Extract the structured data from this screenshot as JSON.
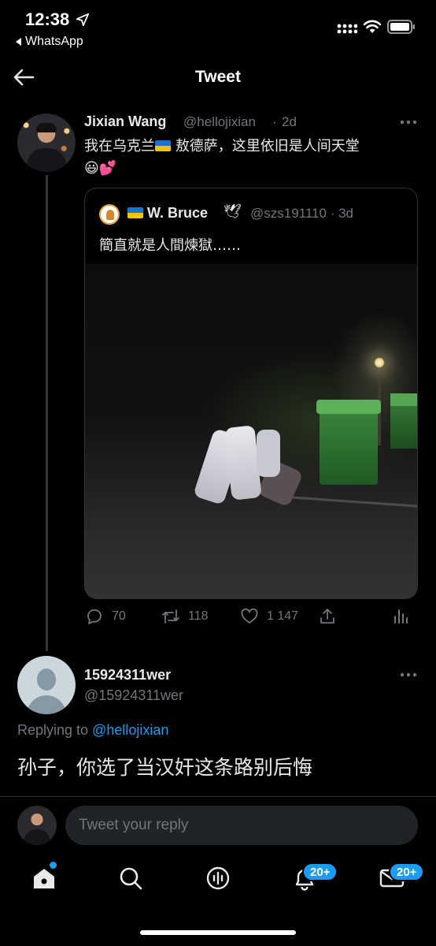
{
  "status_bar": {
    "time": "12:38",
    "back_app": "WhatsApp"
  },
  "header": {
    "title": "Tweet"
  },
  "tweet": {
    "name": "Jixian Wang",
    "handle": "@hellojixian",
    "age": "2d",
    "text_before_flag": "我在乌克兰",
    "text_after_flag": "敖德萨，这里依旧是人间天堂",
    "emoji_line": "😃💕",
    "quoted": {
      "name": "W. Bruce",
      "name_emoji": "🕊",
      "handle": "@szs191110",
      "age": "3d",
      "text": "簡直就是人間煉獄……"
    },
    "actions": {
      "replies": "70",
      "retweets": "118",
      "likes": "1 147"
    }
  },
  "reply": {
    "name": "15924311wer",
    "handle": "@15924311wer",
    "replying_prefix": "Replying to",
    "replying_to": "@hellojixian",
    "text": "孙子，你选了当汉奸这条路别后悔"
  },
  "compose": {
    "placeholder": "Tweet your reply"
  },
  "tab_bar": {
    "notifications_badge": "20+",
    "messages_badge": "20+"
  },
  "colors": {
    "accent": "#1d9bf0",
    "background": "#000000",
    "muted": "#71767b"
  }
}
